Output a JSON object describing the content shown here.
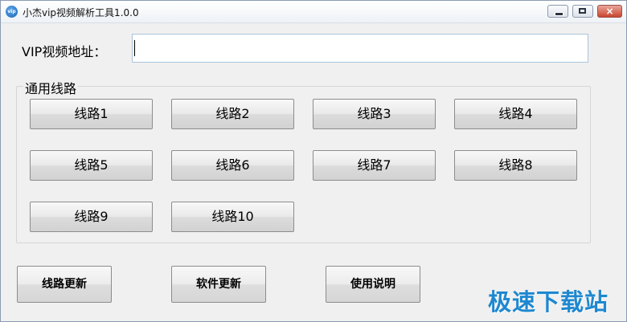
{
  "window": {
    "title": "小杰vip视频解析工具1.0.0",
    "icon": "app-globe-icon",
    "controls": {
      "minimize": "minimize-icon",
      "maximize": "maximize-icon",
      "close": "×"
    }
  },
  "url": {
    "label": "VIP视频地址：",
    "value": "",
    "placeholder": ""
  },
  "group": {
    "label": "通用线路",
    "lines": [
      "线路1",
      "线路2",
      "线路3",
      "线路4",
      "线路5",
      "线路6",
      "线路7",
      "线路8",
      "线路9",
      "线路10"
    ]
  },
  "actions": {
    "update_lines": "线路更新",
    "update_software": "软件更新",
    "instructions": "使用说明"
  },
  "watermark": "极速下载站",
  "colors": {
    "accent": "#1e88d0",
    "close_button": "#c9452f",
    "background": "#f0f0f0"
  }
}
